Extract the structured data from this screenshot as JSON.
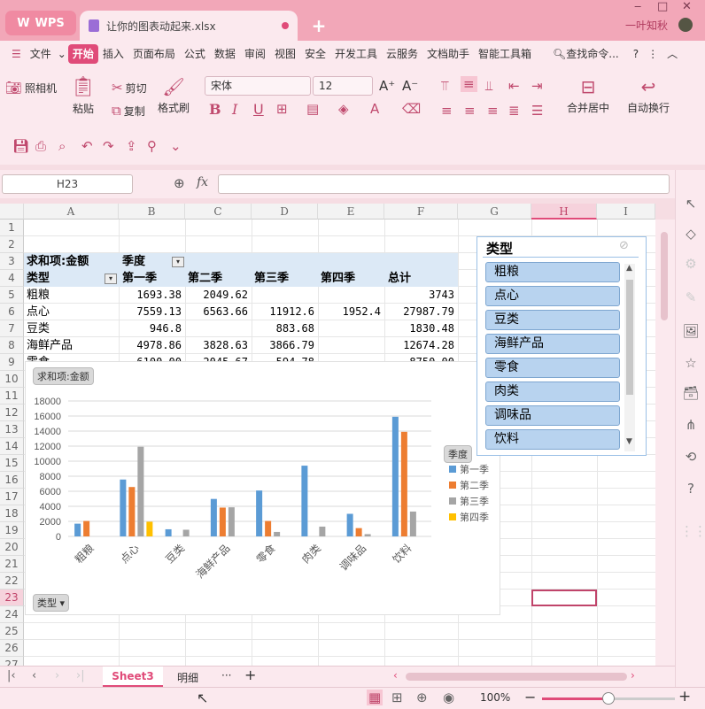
{
  "titlebar": {
    "app_name": "WPS",
    "file_name": "让你的图表动起来.xlsx",
    "user": "一叶知秋",
    "add_tab": "+",
    "controls": [
      "‒",
      "□",
      "✕"
    ]
  },
  "menu": {
    "file": "文件",
    "items": [
      "开始",
      "插入",
      "页面布局",
      "公式",
      "数据",
      "审阅",
      "视图",
      "安全",
      "开发工具",
      "云服务",
      "文档助手",
      "智能工具箱"
    ],
    "search": "查找命令..."
  },
  "ribbon": {
    "camera": "照相机",
    "paste": "粘贴",
    "cut": "剪切",
    "copy": "复制",
    "format_painter": "格式刷",
    "font_name": "宋体",
    "font_size": "12",
    "merge": "合并居中",
    "wrap": "自动换行",
    "bold": "B",
    "italic": "I",
    "underline": "U"
  },
  "formula": {
    "cell_ref": "H23",
    "fx": "fx",
    "value": ""
  },
  "grid": {
    "columns": [
      "A",
      "B",
      "C",
      "D",
      "E",
      "F",
      "G",
      "H",
      "I"
    ],
    "rows": [
      "1",
      "2",
      "3",
      "4",
      "5",
      "6",
      "7",
      "8",
      "9",
      "10",
      "11",
      "12",
      "13",
      "14",
      "15",
      "16",
      "17",
      "18",
      "19",
      "20",
      "21",
      "22",
      "23",
      "24",
      "25",
      "26",
      "27"
    ],
    "selected_col": "H",
    "selected_row": "23"
  },
  "pivot": {
    "data_label": "求和项:金额",
    "col_field": "季度",
    "row_field": "类型",
    "col_headers": [
      "第一季",
      "第二季",
      "第三季",
      "第四季",
      "总计"
    ],
    "rows": [
      {
        "name": "粗粮",
        "q1": "1693.38",
        "q2": "2049.62",
        "q3": "",
        "q4": "",
        "total": "3743"
      },
      {
        "name": "点心",
        "q1": "7559.13",
        "q2": "6563.66",
        "q3": "11912.6",
        "q4": "1952.4",
        "total": "27987.79"
      },
      {
        "name": "豆类",
        "q1": "946.8",
        "q2": "",
        "q3": "883.68",
        "q4": "",
        "total": "1830.48"
      },
      {
        "name": "海鲜产品",
        "q1": "4978.86",
        "q2": "3828.63",
        "q3": "3866.79",
        "q4": "",
        "total": "12674.28"
      },
      {
        "name": "零食",
        "q1": "6100.00",
        "q2": "2045.67",
        "q3": "594.78",
        "q4": "",
        "total": "8750.00"
      }
    ]
  },
  "chart_data": {
    "type": "bar",
    "title": "",
    "field_button": "求和项:金额",
    "axis_button": "类型",
    "legend_title": "季度",
    "categories": [
      "粗粮",
      "点心",
      "豆类",
      "海鲜产品",
      "零食",
      "肉类",
      "调味品",
      "饮料"
    ],
    "series": [
      {
        "name": "第一季",
        "color": "#5b9bd5",
        "values": [
          1693,
          7559,
          947,
          4979,
          6100,
          9400,
          3000,
          15900
        ]
      },
      {
        "name": "第二季",
        "color": "#ed7d31",
        "values": [
          2050,
          6564,
          0,
          3829,
          2050,
          0,
          1100,
          13900
        ]
      },
      {
        "name": "第三季",
        "color": "#a5a5a5",
        "values": [
          0,
          11913,
          884,
          3867,
          595,
          1300,
          300,
          3300
        ]
      },
      {
        "name": "第四季",
        "color": "#ffc000",
        "values": [
          0,
          1952,
          0,
          0,
          0,
          0,
          0,
          0
        ]
      }
    ],
    "yticks": [
      "0",
      "2000",
      "4000",
      "6000",
      "8000",
      "10000",
      "12000",
      "14000",
      "16000",
      "18000"
    ],
    "ylim": [
      0,
      18000
    ],
    "grid": true,
    "legend_position": "right"
  },
  "slicer": {
    "title": "类型",
    "items": [
      "粗粮",
      "点心",
      "豆类",
      "海鲜产品",
      "零食",
      "肉类",
      "调味品",
      "饮料"
    ]
  },
  "sheets": {
    "tabs": [
      "Sheet3",
      "明细"
    ],
    "active": "Sheet3",
    "more": "···",
    "add": "+"
  },
  "status": {
    "zoom": "100%",
    "zoom_level": 0.5
  }
}
